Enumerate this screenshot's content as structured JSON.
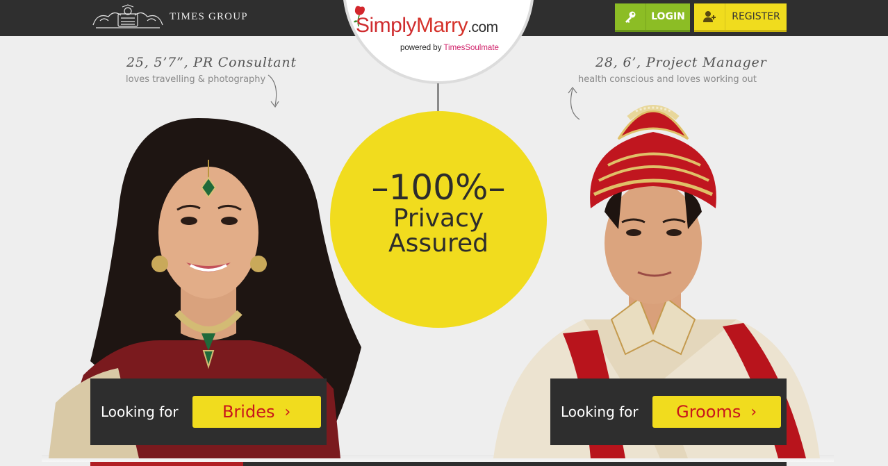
{
  "header": {
    "times_group_label": "TIMES GROUP",
    "login_label": "LOGIN",
    "register_label": "REGISTER",
    "login_icon": "key-icon",
    "register_icon": "add-user-icon"
  },
  "logo": {
    "simply": "Simply",
    "marry": "Marry",
    "dotcom": ".com",
    "powered_by": "powered by ",
    "times_soulmate": "TimesSoulmate"
  },
  "privacy": {
    "percent": "–100%–",
    "line1": "Privacy",
    "line2": "Assured"
  },
  "bride": {
    "profile_title": "25, 5’7”, PR Consultant",
    "profile_sub": "loves travelling & photography",
    "looking_label": "Looking for",
    "button_label": "Brides",
    "chevron": "›"
  },
  "groom": {
    "profile_title": "28, 6’, Project Manager",
    "profile_sub": "health conscious and loves working out",
    "looking_label": "Looking for",
    "button_label": "Grooms",
    "chevron": "›"
  },
  "colors": {
    "topbar": "#2f2f2f",
    "login_green": "#8cbd25",
    "yellow": "#f1dc1e",
    "red_text": "#c8161c",
    "dark_box": "#2e2e2e"
  }
}
